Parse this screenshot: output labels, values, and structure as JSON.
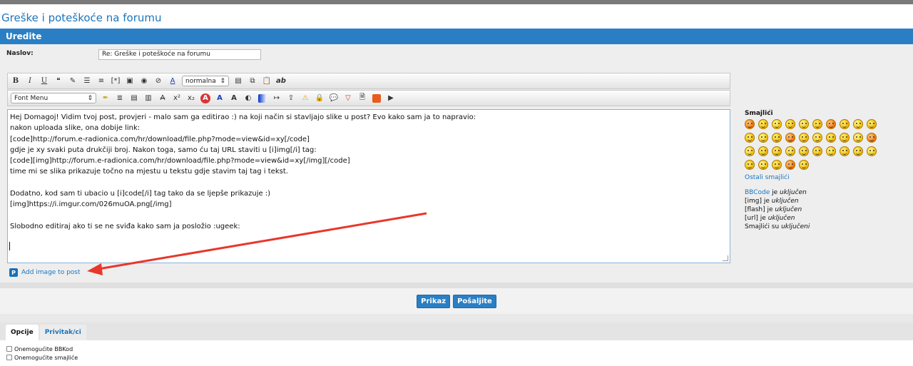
{
  "page_title": "Greške i poteškoće na forumu",
  "section_title": "Uredite",
  "subject": {
    "label": "Naslov:",
    "value": "Re: Greške i poteškoće na forumu"
  },
  "toolbar": {
    "size_select": "normalna",
    "font_select": "Font Menu",
    "bold": "B",
    "italic": "I",
    "underline": "U",
    "ab_label": "ab",
    "sup": "x²",
    "sub": "x₂"
  },
  "editor": {
    "lines": [
      "Hej Domagoj! Vidim tvoj post, provjeri - malo sam ga editirao :) na koji način si stavljajo slike u post? Evo kako sam ja to napravio:",
      "nakon uploada slike, ona dobije link:",
      "[code]http://forum.e-radionica.com/hr/download/file.php?mode=view&id=xy[/code]",
      "gdje je xy svaki puta drukčiji broj. Nakon toga, samo ću taj URL staviti u [i]img[/i] tag:",
      "[code][img]http://forum.e-radionica.com/hr/download/file.php?mode=view&id=xy[/img][/code]",
      "time mi se slika prikazuje točno na mjestu u tekstu gdje stavim taj tag i tekst.",
      "",
      "Dodatno, kod sam ti ubacio u [i]code[/i] tag tako da se ljepše prikazuje :)",
      "[img]https://i.imgur.com/026muOA.png[/img]",
      "",
      "Slobodno editiraj ako ti se ne sviđa kako sam ja posložio :ugeek:"
    ]
  },
  "add_image": "Add image to post",
  "sidebar": {
    "smilies_title": "Smajlići",
    "more_smilies": "Ostali smajlići",
    "bbcode_link": "BBCode",
    "bbcode_rest": " je ",
    "bbcode_state": "uključen",
    "img_line": "[img] je ",
    "img_state": "uključen",
    "flash_line": "[flash] je ",
    "flash_state": "uključen",
    "url_line": "[url] je ",
    "url_state": "uključen",
    "smilies_line": "Smajlići su ",
    "smilies_state": "uključeni"
  },
  "buttons": {
    "preview": "Prikaz",
    "submit": "Pošaljite"
  },
  "tabs": [
    {
      "label": "Opcije"
    },
    {
      "label": "Privitak/ci"
    }
  ],
  "options": [
    {
      "label": "Onemogućite BBKod"
    },
    {
      "label": "Onemogućite smajliće"
    }
  ],
  "colors": {
    "accent": "#2a7fc4",
    "link": "#1c75bc",
    "arrow": "#e8372b"
  }
}
